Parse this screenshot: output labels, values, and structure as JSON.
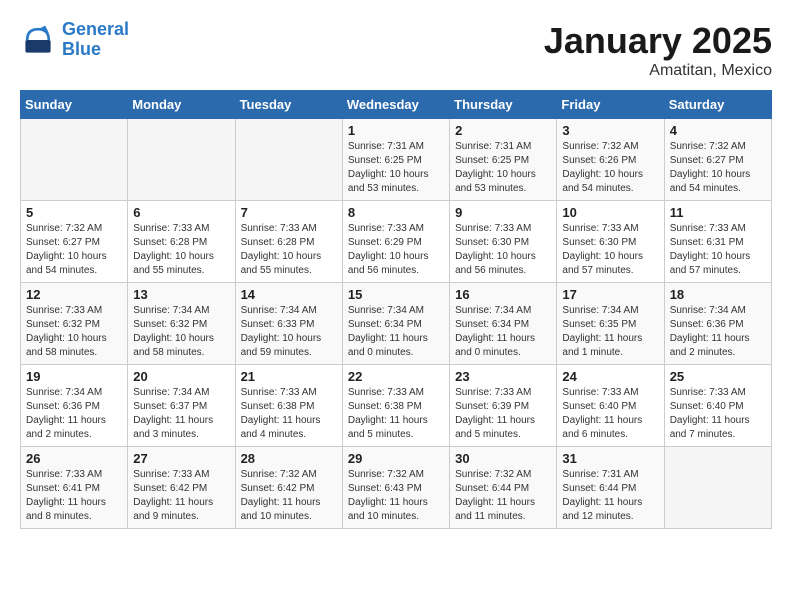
{
  "header": {
    "logo_line1": "General",
    "logo_line2": "Blue",
    "title": "January 2025",
    "subtitle": "Amatitan, Mexico"
  },
  "weekdays": [
    "Sunday",
    "Monday",
    "Tuesday",
    "Wednesday",
    "Thursday",
    "Friday",
    "Saturday"
  ],
  "weeks": [
    [
      {
        "day": "",
        "sunrise": "",
        "sunset": "",
        "daylight": ""
      },
      {
        "day": "",
        "sunrise": "",
        "sunset": "",
        "daylight": ""
      },
      {
        "day": "",
        "sunrise": "",
        "sunset": "",
        "daylight": ""
      },
      {
        "day": "1",
        "sunrise": "Sunrise: 7:31 AM",
        "sunset": "Sunset: 6:25 PM",
        "daylight": "Daylight: 10 hours and 53 minutes."
      },
      {
        "day": "2",
        "sunrise": "Sunrise: 7:31 AM",
        "sunset": "Sunset: 6:25 PM",
        "daylight": "Daylight: 10 hours and 53 minutes."
      },
      {
        "day": "3",
        "sunrise": "Sunrise: 7:32 AM",
        "sunset": "Sunset: 6:26 PM",
        "daylight": "Daylight: 10 hours and 54 minutes."
      },
      {
        "day": "4",
        "sunrise": "Sunrise: 7:32 AM",
        "sunset": "Sunset: 6:27 PM",
        "daylight": "Daylight: 10 hours and 54 minutes."
      }
    ],
    [
      {
        "day": "5",
        "sunrise": "Sunrise: 7:32 AM",
        "sunset": "Sunset: 6:27 PM",
        "daylight": "Daylight: 10 hours and 54 minutes."
      },
      {
        "day": "6",
        "sunrise": "Sunrise: 7:33 AM",
        "sunset": "Sunset: 6:28 PM",
        "daylight": "Daylight: 10 hours and 55 minutes."
      },
      {
        "day": "7",
        "sunrise": "Sunrise: 7:33 AM",
        "sunset": "Sunset: 6:28 PM",
        "daylight": "Daylight: 10 hours and 55 minutes."
      },
      {
        "day": "8",
        "sunrise": "Sunrise: 7:33 AM",
        "sunset": "Sunset: 6:29 PM",
        "daylight": "Daylight: 10 hours and 56 minutes."
      },
      {
        "day": "9",
        "sunrise": "Sunrise: 7:33 AM",
        "sunset": "Sunset: 6:30 PM",
        "daylight": "Daylight: 10 hours and 56 minutes."
      },
      {
        "day": "10",
        "sunrise": "Sunrise: 7:33 AM",
        "sunset": "Sunset: 6:30 PM",
        "daylight": "Daylight: 10 hours and 57 minutes."
      },
      {
        "day": "11",
        "sunrise": "Sunrise: 7:33 AM",
        "sunset": "Sunset: 6:31 PM",
        "daylight": "Daylight: 10 hours and 57 minutes."
      }
    ],
    [
      {
        "day": "12",
        "sunrise": "Sunrise: 7:33 AM",
        "sunset": "Sunset: 6:32 PM",
        "daylight": "Daylight: 10 hours and 58 minutes."
      },
      {
        "day": "13",
        "sunrise": "Sunrise: 7:34 AM",
        "sunset": "Sunset: 6:32 PM",
        "daylight": "Daylight: 10 hours and 58 minutes."
      },
      {
        "day": "14",
        "sunrise": "Sunrise: 7:34 AM",
        "sunset": "Sunset: 6:33 PM",
        "daylight": "Daylight: 10 hours and 59 minutes."
      },
      {
        "day": "15",
        "sunrise": "Sunrise: 7:34 AM",
        "sunset": "Sunset: 6:34 PM",
        "daylight": "Daylight: 11 hours and 0 minutes."
      },
      {
        "day": "16",
        "sunrise": "Sunrise: 7:34 AM",
        "sunset": "Sunset: 6:34 PM",
        "daylight": "Daylight: 11 hours and 0 minutes."
      },
      {
        "day": "17",
        "sunrise": "Sunrise: 7:34 AM",
        "sunset": "Sunset: 6:35 PM",
        "daylight": "Daylight: 11 hours and 1 minute."
      },
      {
        "day": "18",
        "sunrise": "Sunrise: 7:34 AM",
        "sunset": "Sunset: 6:36 PM",
        "daylight": "Daylight: 11 hours and 2 minutes."
      }
    ],
    [
      {
        "day": "19",
        "sunrise": "Sunrise: 7:34 AM",
        "sunset": "Sunset: 6:36 PM",
        "daylight": "Daylight: 11 hours and 2 minutes."
      },
      {
        "day": "20",
        "sunrise": "Sunrise: 7:34 AM",
        "sunset": "Sunset: 6:37 PM",
        "daylight": "Daylight: 11 hours and 3 minutes."
      },
      {
        "day": "21",
        "sunrise": "Sunrise: 7:33 AM",
        "sunset": "Sunset: 6:38 PM",
        "daylight": "Daylight: 11 hours and 4 minutes."
      },
      {
        "day": "22",
        "sunrise": "Sunrise: 7:33 AM",
        "sunset": "Sunset: 6:38 PM",
        "daylight": "Daylight: 11 hours and 5 minutes."
      },
      {
        "day": "23",
        "sunrise": "Sunrise: 7:33 AM",
        "sunset": "Sunset: 6:39 PM",
        "daylight": "Daylight: 11 hours and 5 minutes."
      },
      {
        "day": "24",
        "sunrise": "Sunrise: 7:33 AM",
        "sunset": "Sunset: 6:40 PM",
        "daylight": "Daylight: 11 hours and 6 minutes."
      },
      {
        "day": "25",
        "sunrise": "Sunrise: 7:33 AM",
        "sunset": "Sunset: 6:40 PM",
        "daylight": "Daylight: 11 hours and 7 minutes."
      }
    ],
    [
      {
        "day": "26",
        "sunrise": "Sunrise: 7:33 AM",
        "sunset": "Sunset: 6:41 PM",
        "daylight": "Daylight: 11 hours and 8 minutes."
      },
      {
        "day": "27",
        "sunrise": "Sunrise: 7:33 AM",
        "sunset": "Sunset: 6:42 PM",
        "daylight": "Daylight: 11 hours and 9 minutes."
      },
      {
        "day": "28",
        "sunrise": "Sunrise: 7:32 AM",
        "sunset": "Sunset: 6:42 PM",
        "daylight": "Daylight: 11 hours and 10 minutes."
      },
      {
        "day": "29",
        "sunrise": "Sunrise: 7:32 AM",
        "sunset": "Sunset: 6:43 PM",
        "daylight": "Daylight: 11 hours and 10 minutes."
      },
      {
        "day": "30",
        "sunrise": "Sunrise: 7:32 AM",
        "sunset": "Sunset: 6:44 PM",
        "daylight": "Daylight: 11 hours and 11 minutes."
      },
      {
        "day": "31",
        "sunrise": "Sunrise: 7:31 AM",
        "sunset": "Sunset: 6:44 PM",
        "daylight": "Daylight: 11 hours and 12 minutes."
      },
      {
        "day": "",
        "sunrise": "",
        "sunset": "",
        "daylight": ""
      }
    ]
  ]
}
